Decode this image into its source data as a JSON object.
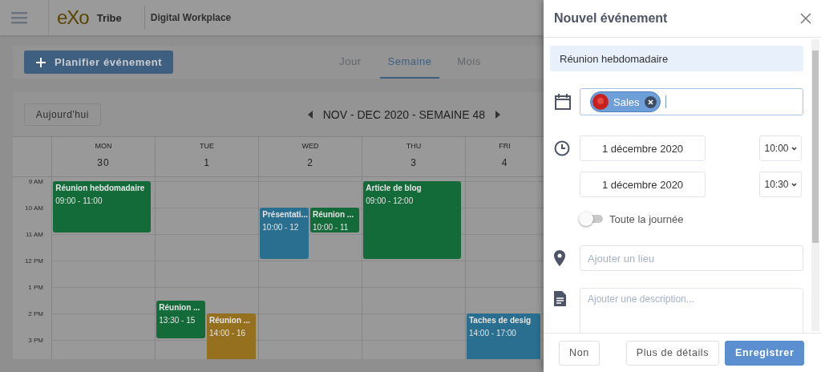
{
  "header": {
    "logo": "eXo",
    "brand": "Tribe",
    "title": "Digital Workplace"
  },
  "toolbar": {
    "create_button": "Planifier événement",
    "views": [
      {
        "label": "Jour",
        "selected": false
      },
      {
        "label": "Semaine",
        "selected": true
      },
      {
        "label": "Mois",
        "selected": false
      }
    ]
  },
  "calendar": {
    "today_button": "Aujourd'hui",
    "period": "NOV - DEC 2020 - SEMAINE 48",
    "hours": [
      "9 AM",
      "10 AM",
      "11 AM",
      "12 PM",
      "1 PM",
      "2 PM",
      "3 PM"
    ],
    "days": [
      {
        "name": "MON",
        "date": "30",
        "events": [
          {
            "title": "Réunion hebdomadaire",
            "time": "09:00 - 11:00",
            "color": "#146b3a"
          }
        ]
      },
      {
        "name": "TUE",
        "date": "1",
        "events": [
          {
            "title": "Réunion ...",
            "time": "13:30 - 15",
            "color": "#146b3a"
          },
          {
            "title": "Réunion ...",
            "time": "14:00 - 16",
            "color": "#94701f"
          }
        ]
      },
      {
        "name": "WED",
        "date": "2",
        "events": [
          {
            "title": "Présentati...",
            "time": "10:00 - 12",
            "color": "#2a6f8f"
          },
          {
            "title": "Réunion ...",
            "time": "10:00 - 11",
            "color": "#146b3a"
          }
        ]
      },
      {
        "name": "THU",
        "date": "3",
        "events": [
          {
            "title": "Article de blog",
            "time": "09:00 - 12:00",
            "color": "#146b3a"
          }
        ]
      },
      {
        "name": "FRI",
        "date": "4",
        "events": [
          {
            "title": "Taches de desig",
            "time": "14:00 - 17:00",
            "color": "#2a6f8f"
          }
        ]
      }
    ]
  },
  "drawer": {
    "title": "Nouvel événement",
    "event_title": "Réunion hebdomadaire",
    "calendar_chip": "Sales",
    "start_date": "1 décembre 2020",
    "start_time": "10:00",
    "end_date": "1 décembre 2020",
    "end_time": "10:30",
    "all_day": {
      "label": "Toute la journée",
      "on": false
    },
    "location": {
      "placeholder": "Ajouter un lieu"
    },
    "description": {
      "placeholder": "Ajouter une description..."
    },
    "buttons": [
      {
        "label": "Non",
        "kind": "plain"
      },
      {
        "label": "Plus de détails",
        "kind": "plain"
      },
      {
        "label": "Enregistrer",
        "kind": "primary"
      }
    ]
  }
}
